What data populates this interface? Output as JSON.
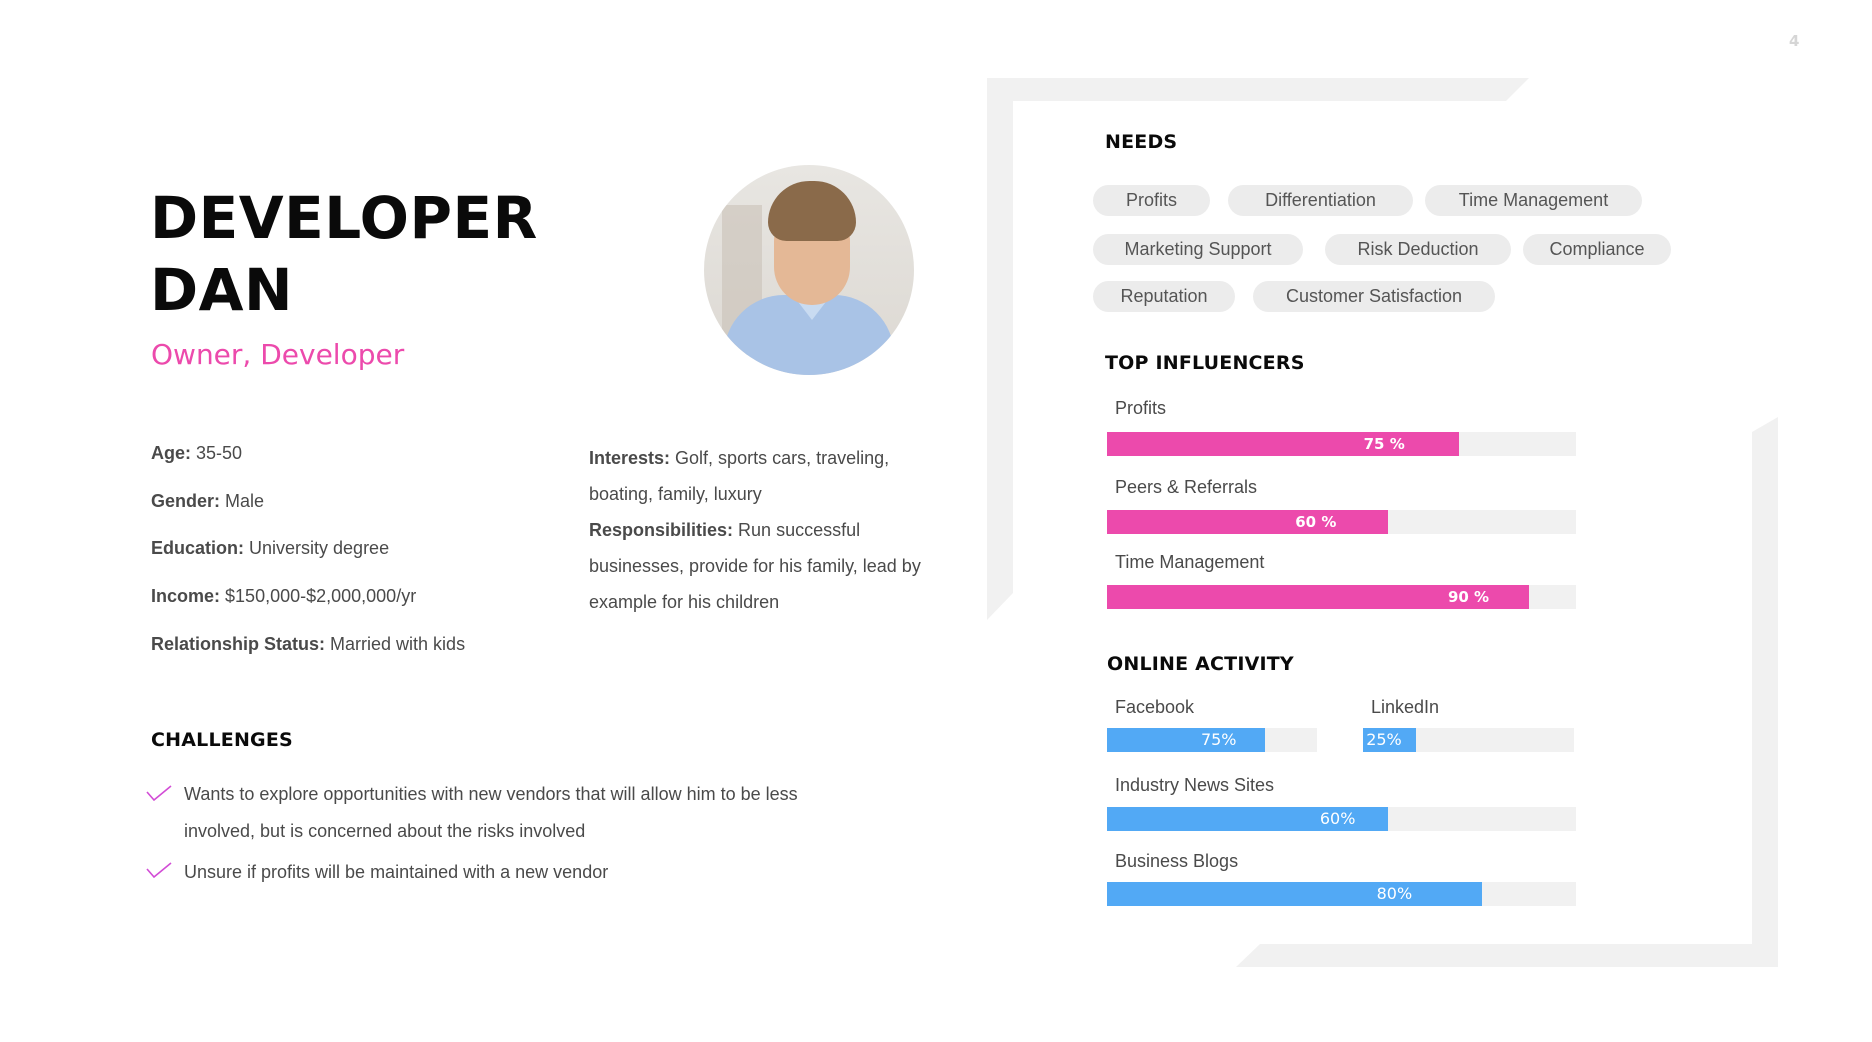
{
  "page_number": "4",
  "persona": {
    "name": "DEVELOPER\nDAN",
    "role": "Owner, Developer"
  },
  "facts": [
    {
      "label": "Age:",
      "value": "35-50"
    },
    {
      "label": "Gender:",
      "value": "Male"
    },
    {
      "label": "Education:",
      "value": "University degree"
    },
    {
      "label": "Income:",
      "value": "$150,000-$2,000,000/yr"
    },
    {
      "label": "Relationship Status:",
      "value": "Married with kids"
    }
  ],
  "interests": {
    "label": "Interests:",
    "value": "Golf, sports cars, traveling, boating, family, luxury"
  },
  "responsibilities": {
    "label": "Responsibilities:",
    "value": "Run successful businesses, provide for his family, lead by example for his children"
  },
  "challenges": {
    "heading": "CHALLENGES",
    "items": [
      "Wants to explore opportunities with new vendors that will allow him to be less involved, but is concerned about the risks involved",
      "Unsure if profits will be maintained with a new vendor"
    ]
  },
  "needs": {
    "heading": "NEEDS",
    "items": [
      "Profits",
      "Differentiation",
      "Time Management",
      "Marketing Support",
      "Risk Deduction",
      "Compliance",
      "Reputation",
      "Customer Satisfaction"
    ]
  },
  "top_influencers": {
    "heading": "TOP INFLUENCERS",
    "items": [
      {
        "label": "Profits",
        "value": 75,
        "text": "75 %"
      },
      {
        "label": "Peers & Referrals",
        "value": 60,
        "text": "60 %"
      },
      {
        "label": "Time Management",
        "value": 90,
        "text": "90 %"
      }
    ]
  },
  "online_activity": {
    "heading": "ONLINE ACTIVITY",
    "items": [
      {
        "label": "Facebook",
        "value": 75,
        "text": "75%"
      },
      {
        "label": "LinkedIn",
        "value": 25,
        "text": "25%"
      },
      {
        "label": "Industry News Sites",
        "value": 60,
        "text": "60%"
      },
      {
        "label": "Business Blogs",
        "value": 80,
        "text": "80%"
      }
    ]
  },
  "colors": {
    "accent_pink": "#ec4aac",
    "accent_blue": "#52a9f5",
    "track": "#f1f1f1",
    "pill": "#ececec"
  }
}
